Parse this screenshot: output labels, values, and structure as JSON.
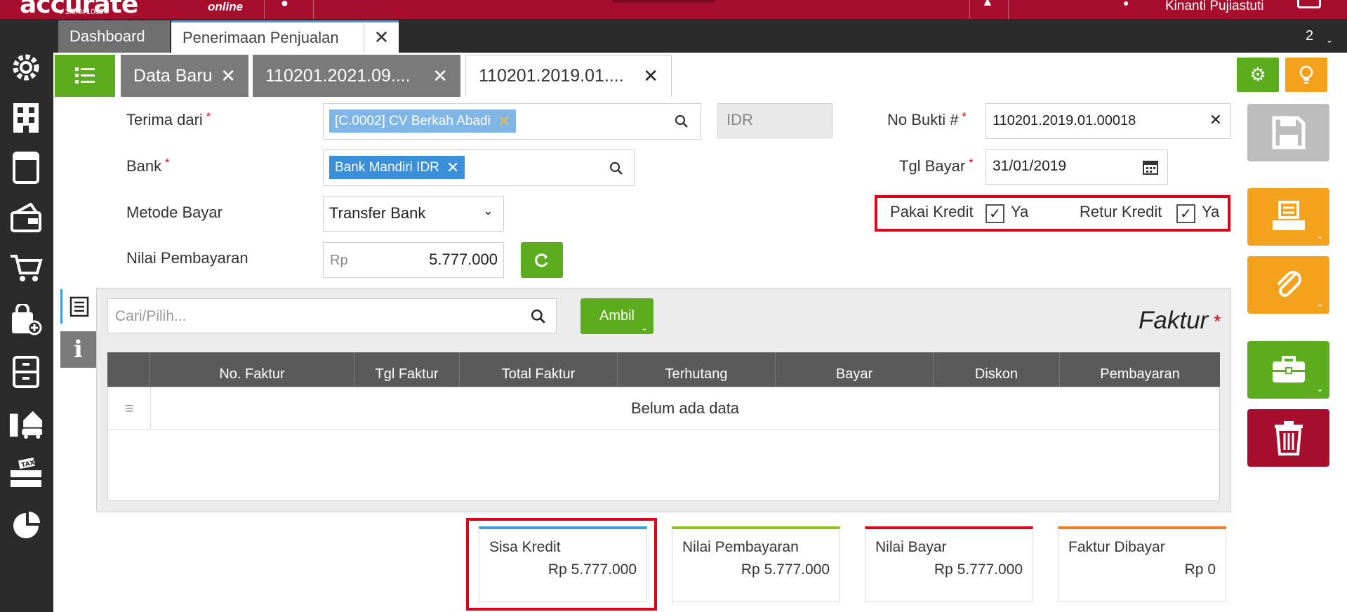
{
  "topbar": {
    "logo": "accurate",
    "logo_suffix": "online",
    "version": "v 1.0.0#10684",
    "username": "Kinanti Pujiastuti"
  },
  "sidebar": {
    "items": [
      {
        "icon": "gear-icon"
      },
      {
        "icon": "building-icon"
      },
      {
        "icon": "book-icon"
      },
      {
        "icon": "payment-icon"
      },
      {
        "icon": "cart-icon"
      },
      {
        "icon": "shopping-bag-icon"
      },
      {
        "icon": "cabinet-icon"
      },
      {
        "icon": "assets-icon"
      },
      {
        "icon": "tax-icon"
      },
      {
        "icon": "pie-chart-icon"
      }
    ]
  },
  "tabs": {
    "dashboard": "Dashboard",
    "active": "Penerimaan Penjualan",
    "count": "2"
  },
  "doc_tabs": [
    {
      "label": "Data Baru"
    },
    {
      "label": "110201.2021.09...."
    },
    {
      "label": "110201.2019.01...."
    }
  ],
  "form": {
    "terima_dari_label": "Terima dari",
    "terima_dari_value": "[C.0002] CV Berkah Abadi",
    "currency": "IDR",
    "bank_label": "Bank",
    "bank_value": "Bank Mandiri IDR",
    "metode_label": "Metode Bayar",
    "metode_value": "Transfer Bank",
    "nilai_label": "Nilai Pembayaran",
    "nilai_prefix": "Rp",
    "nilai_value": "5.777.000",
    "no_bukti_label": "No Bukti #",
    "no_bukti_value": "110201.2019.01.00018",
    "tgl_label": "Tgl Bayar",
    "tgl_value": "31/01/2019",
    "pakai_kredit_label": "Pakai Kredit",
    "pakai_kredit_value": "Ya",
    "retur_kredit_label": "Retur Kredit",
    "retur_kredit_value": "Ya"
  },
  "grid": {
    "search_placeholder": "Cari/Pilih...",
    "ambil_label": "Ambil",
    "title": "Faktur",
    "columns": [
      "No. Faktur",
      "Tgl Faktur",
      "Total Faktur",
      "Terhutang",
      "Bayar",
      "Diskon",
      "Pembayaran"
    ],
    "empty_text": "Belum ada data"
  },
  "summary": [
    {
      "title": "Sisa Kredit",
      "value": "Rp 5.777.000",
      "accent": "#3a9de0"
    },
    {
      "title": "Nilai Pembayaran",
      "value": "Rp 5.777.000",
      "accent": "#8cc21f"
    },
    {
      "title": "Nilai Bayar",
      "value": "Rp 5.777.000",
      "accent": "#e0001b"
    },
    {
      "title": "Faktur Dibayar",
      "value": "Rp 0",
      "accent": "#f07b22"
    }
  ],
  "colors": {
    "brand": "#a70d2c",
    "green": "#5cad1e",
    "orange": "#f4a11c",
    "red_button": "#a70d2c",
    "highlight": "#e0001b"
  }
}
